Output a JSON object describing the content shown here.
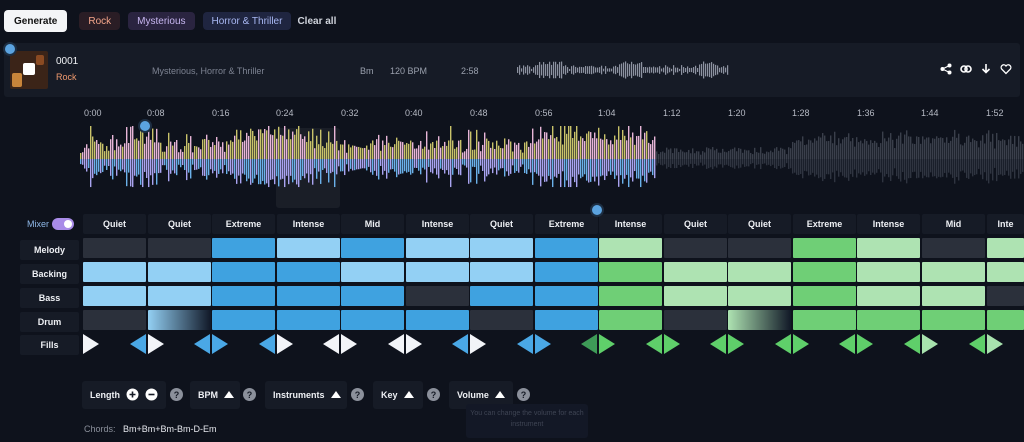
{
  "topbar": {
    "generate_label": "Generate",
    "tags": [
      "Rock",
      "Mysterious",
      "Horror & Thriller"
    ],
    "clear_label": "Clear all"
  },
  "track": {
    "number": "0001",
    "genre": "Rock",
    "moods": "Mysterious, Horror & Thriller",
    "key": "Bm",
    "bpm": "120 BPM",
    "duration": "2:58",
    "actions": [
      "share-icon",
      "link-icon",
      "download-icon",
      "heart-icon"
    ]
  },
  "timeline": {
    "ticks": [
      "0:00",
      "0:08",
      "0:16",
      "0:24",
      "0:32",
      "0:40",
      "0:48",
      "0:56",
      "1:04",
      "1:12",
      "1:20",
      "1:28",
      "1:36",
      "1:44",
      "1:52"
    ]
  },
  "mixer": {
    "label": "Mixer",
    "enabled": true,
    "intensities": [
      "Quiet",
      "Quiet",
      "Extreme",
      "Intense",
      "Mid",
      "Intense",
      "Quiet",
      "Extreme",
      "Intense",
      "Quiet",
      "Quiet",
      "Extreme",
      "Intense",
      "Mid",
      "Inte"
    ],
    "rows": [
      "Melody",
      "Backing",
      "Bass",
      "Drum",
      "Fills"
    ]
  },
  "controls": {
    "length_label": "Length",
    "bpm_label": "BPM",
    "instruments_label": "Instruments",
    "key_label": "Key",
    "volume_label": "Volume",
    "help_glyph": "?",
    "tooltip_text": "You can change the volume for each instrument"
  },
  "chords": {
    "label": "Chords:",
    "value": "Bm+Bm+Bm-Bm-D-Em"
  },
  "colors": {
    "blue_dark": "#3fa2e0",
    "blue_light": "#93d0f4",
    "green_dark": "#6fcf76",
    "green_light": "#aee3b2",
    "cell_off": "#2b303b"
  }
}
